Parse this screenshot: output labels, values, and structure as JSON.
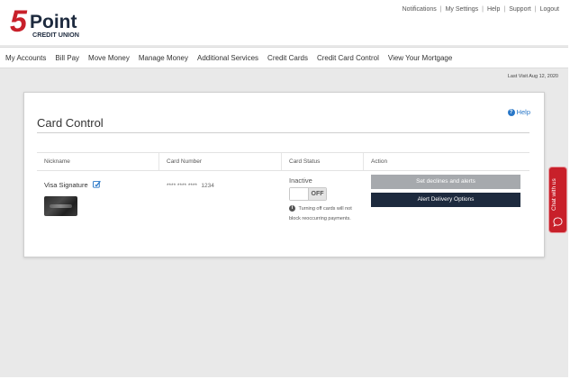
{
  "brand": {
    "logo_number": "5",
    "logo_word": "Point",
    "logo_sub": "CREDIT UNION",
    "primary_color": "#c8202a",
    "navy_color": "#1d2a3e"
  },
  "utility_links": [
    "Notifications",
    "My Settings",
    "Help",
    "Support",
    "Logout"
  ],
  "nav": {
    "items": [
      "My Accounts",
      "Bill Pay",
      "Move Money",
      "Manage Money",
      "Additional Services",
      "Credit Cards",
      "Credit Card Control",
      "View Your Mortgage"
    ]
  },
  "last_visit": "Last Visit Aug 12, 2020",
  "page": {
    "title": "Card Control",
    "help_label": "Help"
  },
  "table": {
    "headers": [
      "Nickname",
      "Card Number",
      "Card Status",
      "Action"
    ],
    "rows": [
      {
        "nickname": "Visa Signature",
        "card_masked": "**** **** ****",
        "card_last4": "1234",
        "status": "Inactive",
        "toggle_label": "OFF",
        "note": "Turning off cards will not block reoccurring payments.",
        "btn_declines": "Set declines and alerts",
        "btn_alerts": "Alert Delivery Options"
      }
    ]
  },
  "chat": {
    "label": "Chat with us"
  }
}
